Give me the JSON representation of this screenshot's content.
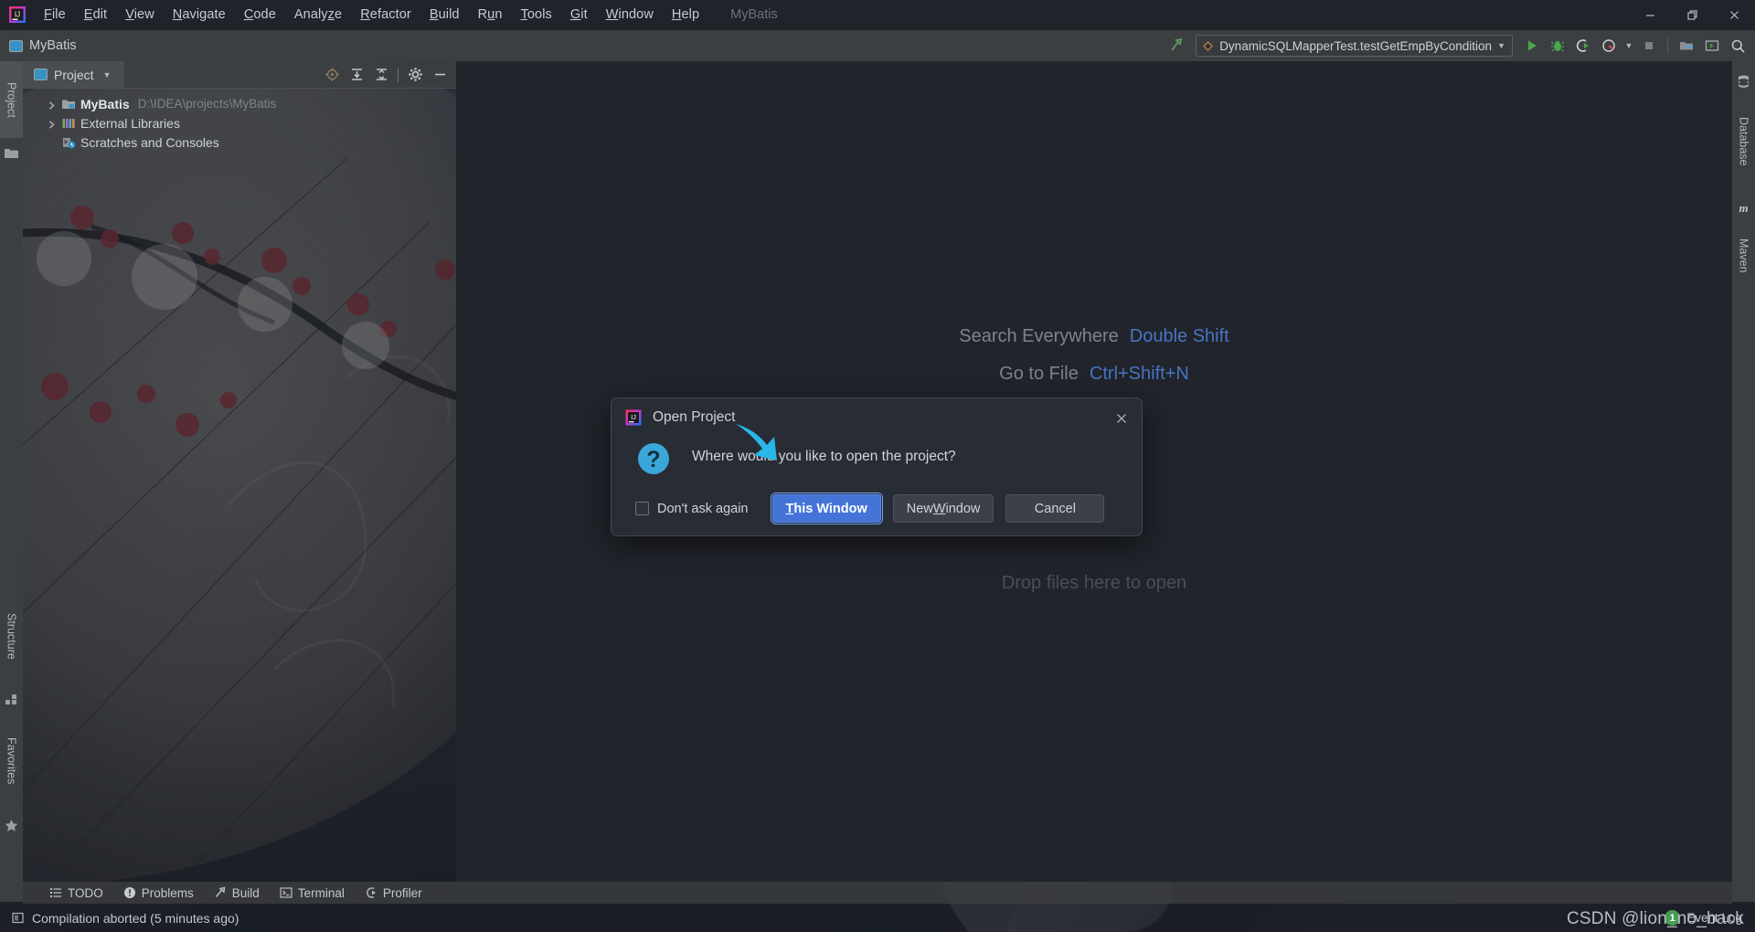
{
  "window": {
    "app_title": "MyBatis",
    "project_name": "MyBatis",
    "minimize": "—",
    "restore": "❐",
    "close": "✕"
  },
  "menubar": {
    "items": [
      {
        "label": "File",
        "mnemonic": "F"
      },
      {
        "label": "Edit",
        "mnemonic": "E"
      },
      {
        "label": "View",
        "mnemonic": "V"
      },
      {
        "label": "Navigate",
        "mnemonic": "N"
      },
      {
        "label": "Code",
        "mnemonic": "C"
      },
      {
        "label": "Analyze",
        "mnemonic": "z"
      },
      {
        "label": "Refactor",
        "mnemonic": "R"
      },
      {
        "label": "Build",
        "mnemonic": "B"
      },
      {
        "label": "Run",
        "mnemonic": "u"
      },
      {
        "label": "Tools",
        "mnemonic": "T"
      },
      {
        "label": "Git",
        "mnemonic": "G"
      },
      {
        "label": "Window",
        "mnemonic": "W"
      },
      {
        "label": "Help",
        "mnemonic": "H"
      }
    ]
  },
  "toolbar": {
    "project_label": "MyBatis",
    "run_config": "DynamicSQLMapperTest.testGetEmpByCondition",
    "run_config_dropdown": "▼",
    "icons": {
      "build_hammer": "build-hammer-icon",
      "run": "run-icon",
      "debug": "debug-icon",
      "run_with_coverage": "run-with-coverage-icon",
      "profile": "profile-icon",
      "profile_dropdown": "▼",
      "stop": "stop-icon",
      "project_structure": "project-structure-icon",
      "toggle_terminal": "toggle-terminal-icon",
      "search": "search-icon"
    }
  },
  "left_strip": {
    "items": [
      {
        "label": "Project",
        "icon": "folder-icon",
        "active": true
      },
      {
        "label": "Structure",
        "icon": "structure-icon",
        "active": false
      },
      {
        "label": "Favorites",
        "icon": "star-icon",
        "active": false
      }
    ]
  },
  "right_strip": {
    "items": [
      {
        "label": "Database",
        "icon": "database-icon"
      },
      {
        "label": "Maven",
        "icon": "maven-m-icon"
      }
    ]
  },
  "project_panel": {
    "tab_label": "Project",
    "tab_dropdown": "▼",
    "actions": [
      {
        "name": "locate-icon",
        "glyph": "◎"
      },
      {
        "name": "expand-all-icon",
        "glyph": "⤓"
      },
      {
        "name": "collapse-all-icon",
        "glyph": "⤒"
      },
      {
        "name": "settings-gear-icon",
        "glyph": "⚙"
      },
      {
        "name": "hide-panel-icon",
        "glyph": "—"
      }
    ],
    "tree": [
      {
        "label": "MyBatis",
        "path": "D:\\IDEA\\projects\\MyBatis",
        "bold": true,
        "expandable": true,
        "icon": "module-icon"
      },
      {
        "label": "External Libraries",
        "path": "",
        "bold": false,
        "expandable": true,
        "icon": "libraries-icon"
      },
      {
        "label": "Scratches and Consoles",
        "path": "",
        "bold": false,
        "expandable": false,
        "icon": "scratches-icon"
      }
    ]
  },
  "editor": {
    "hints": [
      {
        "label": "Search Everywhere",
        "key": "Double Shift"
      },
      {
        "label": "Go to File",
        "key": "Ctrl+Shift+N"
      }
    ],
    "drop_hint": "Drop files here to open"
  },
  "bottom_tools": [
    {
      "label": "TODO",
      "icon": "todo-list-icon"
    },
    {
      "label": "Problems",
      "icon": "problems-warning-icon"
    },
    {
      "label": "Build",
      "icon": "build-hammer-icon"
    },
    {
      "label": "Terminal",
      "icon": "terminal-icon"
    },
    {
      "label": "Profiler",
      "icon": "profiler-icon"
    }
  ],
  "statusbar": {
    "message": "Compilation aborted (5 minutes ago)",
    "message_icon": "message-icon",
    "event_log_label": "Event Log",
    "event_log_count": "1"
  },
  "watermark": "CSDN @lion_no_back",
  "dialog": {
    "title": "Open Project",
    "icon": "intellij-idea-icon",
    "close_glyph": "✕",
    "message": "Where would you like to open the project?",
    "question_icon": "question-mark-icon",
    "checkbox_label": "Don't ask again",
    "checkbox_checked": false,
    "buttons": [
      {
        "label": "This Window",
        "mnemonic": "T",
        "default": true
      },
      {
        "label": "New Window",
        "mnemonic": "W",
        "default": false
      },
      {
        "label": "Cancel",
        "mnemonic": "",
        "default": false
      }
    ]
  },
  "colors": {
    "accent_blue": "#4474d7",
    "hint_key_blue": "#4874c4",
    "toolbar_gray": "#3c3f41",
    "editor_bg": "#21242b",
    "dialog_bg": "#282c34",
    "badge_green": "#499c54",
    "cursor_cyan": "#29b6e8"
  }
}
